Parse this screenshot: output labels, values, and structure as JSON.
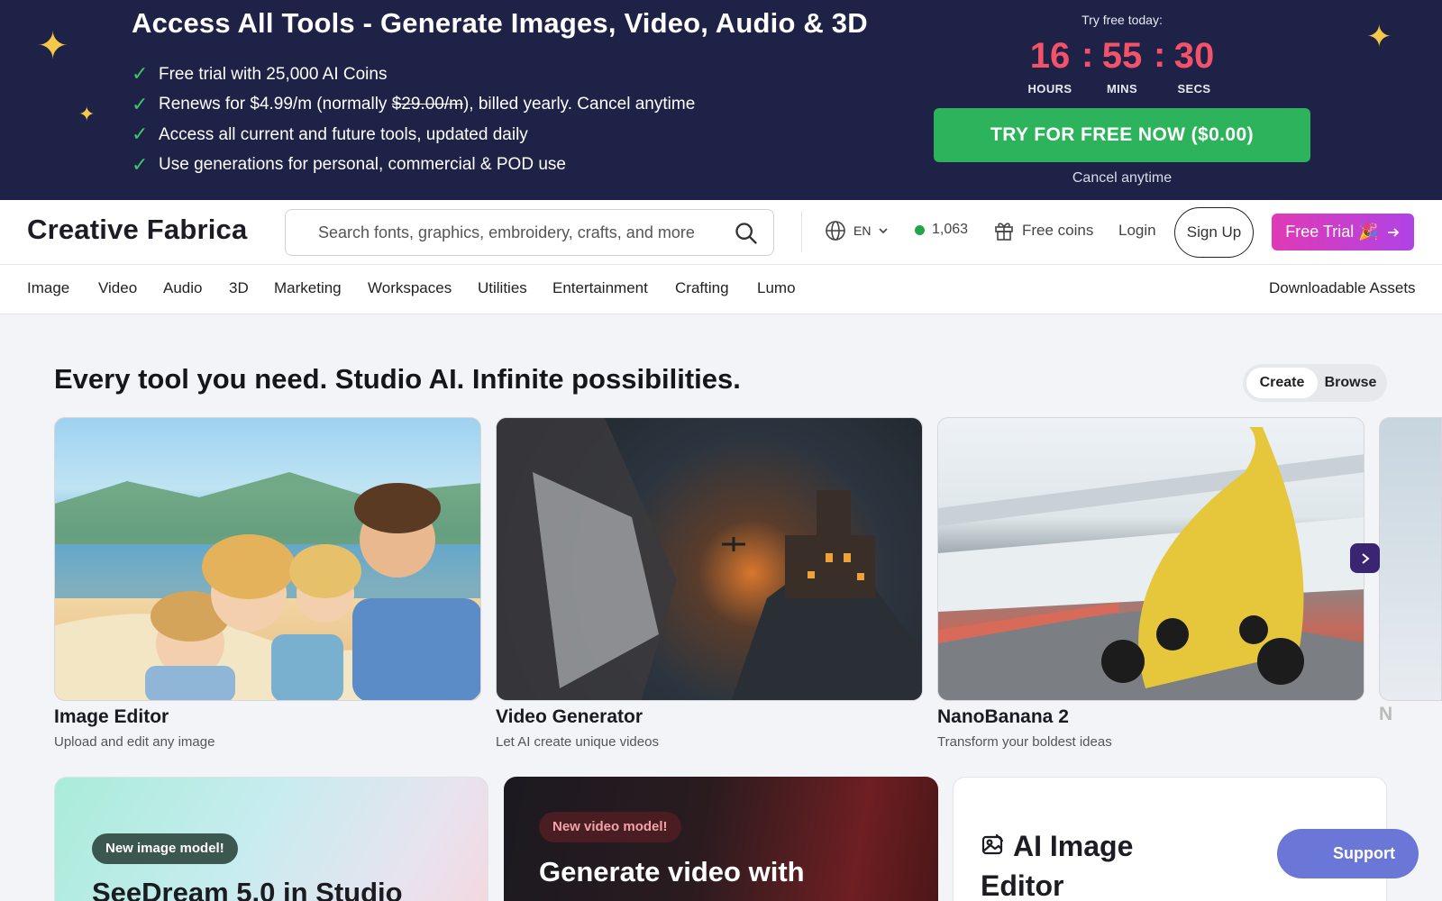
{
  "promo": {
    "title": "Access All Tools - Generate Images, Video, Audio & 3D",
    "bullets": {
      "b1": "Free trial with 25,000 AI Coins",
      "b2_pre": "Renews for $4.99/m (normally ",
      "b2_strike": "$29.00/m",
      "b2_post": "), billed yearly. Cancel anytime",
      "b3": "Access all current and future tools, updated daily",
      "b4": "Use generations for personal, commercial & POD use"
    },
    "timer_label": "Try free today:",
    "hours": "16",
    "mins": "55",
    "secs": "30",
    "hours_label": "HOURS",
    "mins_label": "MINS",
    "secs_label": "SECS",
    "sep": ":",
    "cta": "TRY FOR FREE NOW ($0.00)",
    "cancel": "Cancel anytime"
  },
  "header": {
    "logo": "Creative Fabrica",
    "search_placeholder": "Search fonts, graphics, embroidery, crafts, and more",
    "lang": "EN",
    "online_count": "1,063",
    "free_coins": "Free coins",
    "login": "Login",
    "signup": "Sign Up",
    "free_trial": "Free Trial 🎉"
  },
  "nav": {
    "items": [
      "Image",
      "Video",
      "Audio",
      "3D",
      "Marketing",
      "Workspaces",
      "Utilities",
      "Entertainment",
      "Crafting",
      "Lumo"
    ],
    "right": "Downloadable Assets"
  },
  "main": {
    "headline": "Every tool you need. Studio AI. Infinite possibilities.",
    "toggle_create": "Create",
    "toggle_browse": "Browse",
    "cards": [
      {
        "title": "Image Editor",
        "sub": "Upload and edit any image"
      },
      {
        "title": "Video Generator",
        "sub": "Let AI create unique videos"
      },
      {
        "title": "NanoBanana 2",
        "sub": "Transform your boldest ideas"
      }
    ],
    "peek_title": "N",
    "promo_cards": {
      "seedream_badge": "New image model!",
      "seedream_title": "SeeDream 5.0 in Studio",
      "video_badge": "New video model!",
      "video_title": "Generate video with",
      "editor_title": "AI Image Editor"
    }
  },
  "support": "Support",
  "colors": {
    "banner_bg": "#1e2246",
    "timer_red": "#f2526a",
    "cta_green": "#2db35b",
    "free_trial_gradient_start": "#e03ab5",
    "free_trial_gradient_end": "#b043e6",
    "online_dot": "#22a447",
    "support_bg": "#6a77d6"
  },
  "icons": [
    "sparkle-icon",
    "check-icon",
    "search-icon",
    "globe-icon",
    "chevron-down-icon",
    "gift-icon",
    "arrow-right-icon",
    "chevron-right-icon",
    "image-edit-icon"
  ]
}
